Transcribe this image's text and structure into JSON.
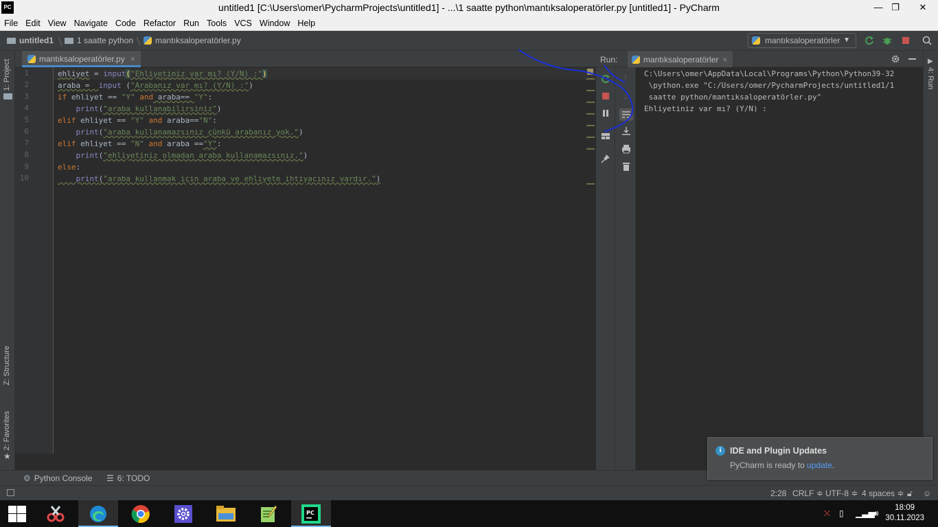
{
  "window": {
    "title": "untitled1 [C:\\Users\\omer\\PycharmProjects\\untitled1] - ...\\1 saatte python\\mantıksaloperatörler.py [untitled1] - PyCharm",
    "app_icon": "PC",
    "minimize": "—",
    "maximize": "❐",
    "close": "✕"
  },
  "menu": [
    "File",
    "Edit",
    "View",
    "Navigate",
    "Code",
    "Refactor",
    "Run",
    "Tools",
    "VCS",
    "Window",
    "Help"
  ],
  "breadcrumb": {
    "project": "untitled1",
    "folder": "1 saatte python",
    "file": "mantıksaloperatörler.py"
  },
  "run_config": {
    "label": "mantıksaloperatörler",
    "chevron": "▼"
  },
  "left_tool_tabs": {
    "project": "1: Project",
    "structure": "Z: Structure",
    "favorites": "2: Favorites"
  },
  "right_tool_tabs": {
    "run": "4: Run"
  },
  "editor": {
    "tab_label": "mantıksaloperatörler.py",
    "tab_close": "×",
    "line_numbers": [
      "1",
      "2",
      "3",
      "4",
      "5",
      "6",
      "7",
      "8",
      "9",
      "10"
    ]
  },
  "code": {
    "l1_var": "ehliyet",
    "l1_op": " = ",
    "l1_fn": "input",
    "l1_po": "(",
    "l1_str": "\"Ehliyetiniz var mı? (Y/N) :\"",
    "l1_pc": ")",
    "l2_var": "araba",
    "l2_op": " =  ",
    "l2_fn": "input",
    "l2_po": " (",
    "l2_str": "\"Arabanız var mı? (Y/N) :\"",
    "l2_pc": ")",
    "l3_kw": "if",
    "l3_a": " ehliyet == ",
    "l3_s1": "\"Y\"",
    "l3_and": " and",
    "l3_b": " araba== ",
    "l3_s2": "\"Y\"",
    "l3_c": ":",
    "l4_ind": "    ",
    "l4_fn": "print",
    "l4_po": "(",
    "l4_str": "\"araba kullanabilirsiniz\"",
    "l4_pc": ")",
    "l5_kw": "elif",
    "l5_a": " ehliyet == ",
    "l5_s1": "\"Y\"",
    "l5_and": " and",
    "l5_b": " araba==",
    "l5_s2": "\"N\"",
    "l5_c": ":",
    "l6_ind": "    ",
    "l6_fn": "print",
    "l6_po": "(",
    "l6_str": "\"araba kullanamazsınız çünkü arabanız yok.\"",
    "l6_pc": ")",
    "l7_kw": "elif",
    "l7_a": " ehliyet == ",
    "l7_s1": "\"N\"",
    "l7_and": " and",
    "l7_b": " araba ==",
    "l7_s2": "\"Y\"",
    "l7_c": ":",
    "l8_ind": "    ",
    "l8_fn": "print",
    "l8_po": "(",
    "l8_str": "\"ehliyetiniz olmadan araba kullanamazsınız.\"",
    "l8_pc": ")",
    "l9_kw": "else",
    "l9_c": ":",
    "l10_ind": "    ",
    "l10_fn": "print",
    "l10_po": "(",
    "l10_str": "\"araba kullanmak için araba ve ehliyete ihtiyacınız vardır.\"",
    "l10_pc": ")"
  },
  "run_panel": {
    "label": "Run:",
    "tab_label": "mantıksaloperatörler",
    "tab_close": "×",
    "console_lines": [
      "C:\\Users\\omer\\AppData\\Local\\Programs\\Python\\Python39-32",
      " \\python.exe \"C:/Users/omer/PycharmProjects/untitled1/1",
      " saatte python/mantıksaloperatörler.py\"",
      "Ehliyetiniz var mı? (Y/N) :"
    ]
  },
  "bottom_tabs": {
    "python_console": "Python Console",
    "todo": "6: TODO"
  },
  "notification": {
    "title": "IDE and Plugin Updates",
    "message": "PyCharm is ready to ",
    "link": "update",
    "suffix": "."
  },
  "status": {
    "position": "2:28",
    "line_sep": "CRLF ≑",
    "encoding": "UTF-8 ≑",
    "indent": "4 spaces ≑"
  },
  "taskbar": {
    "time": "18:09",
    "date": "30.11.2023"
  },
  "colors": {
    "accent": "#4a88c7",
    "keyword": "#cc7832",
    "string": "#6a8759",
    "builtin": "#8888c6",
    "stop_red": "#c75450",
    "run_green": "#499c54"
  }
}
